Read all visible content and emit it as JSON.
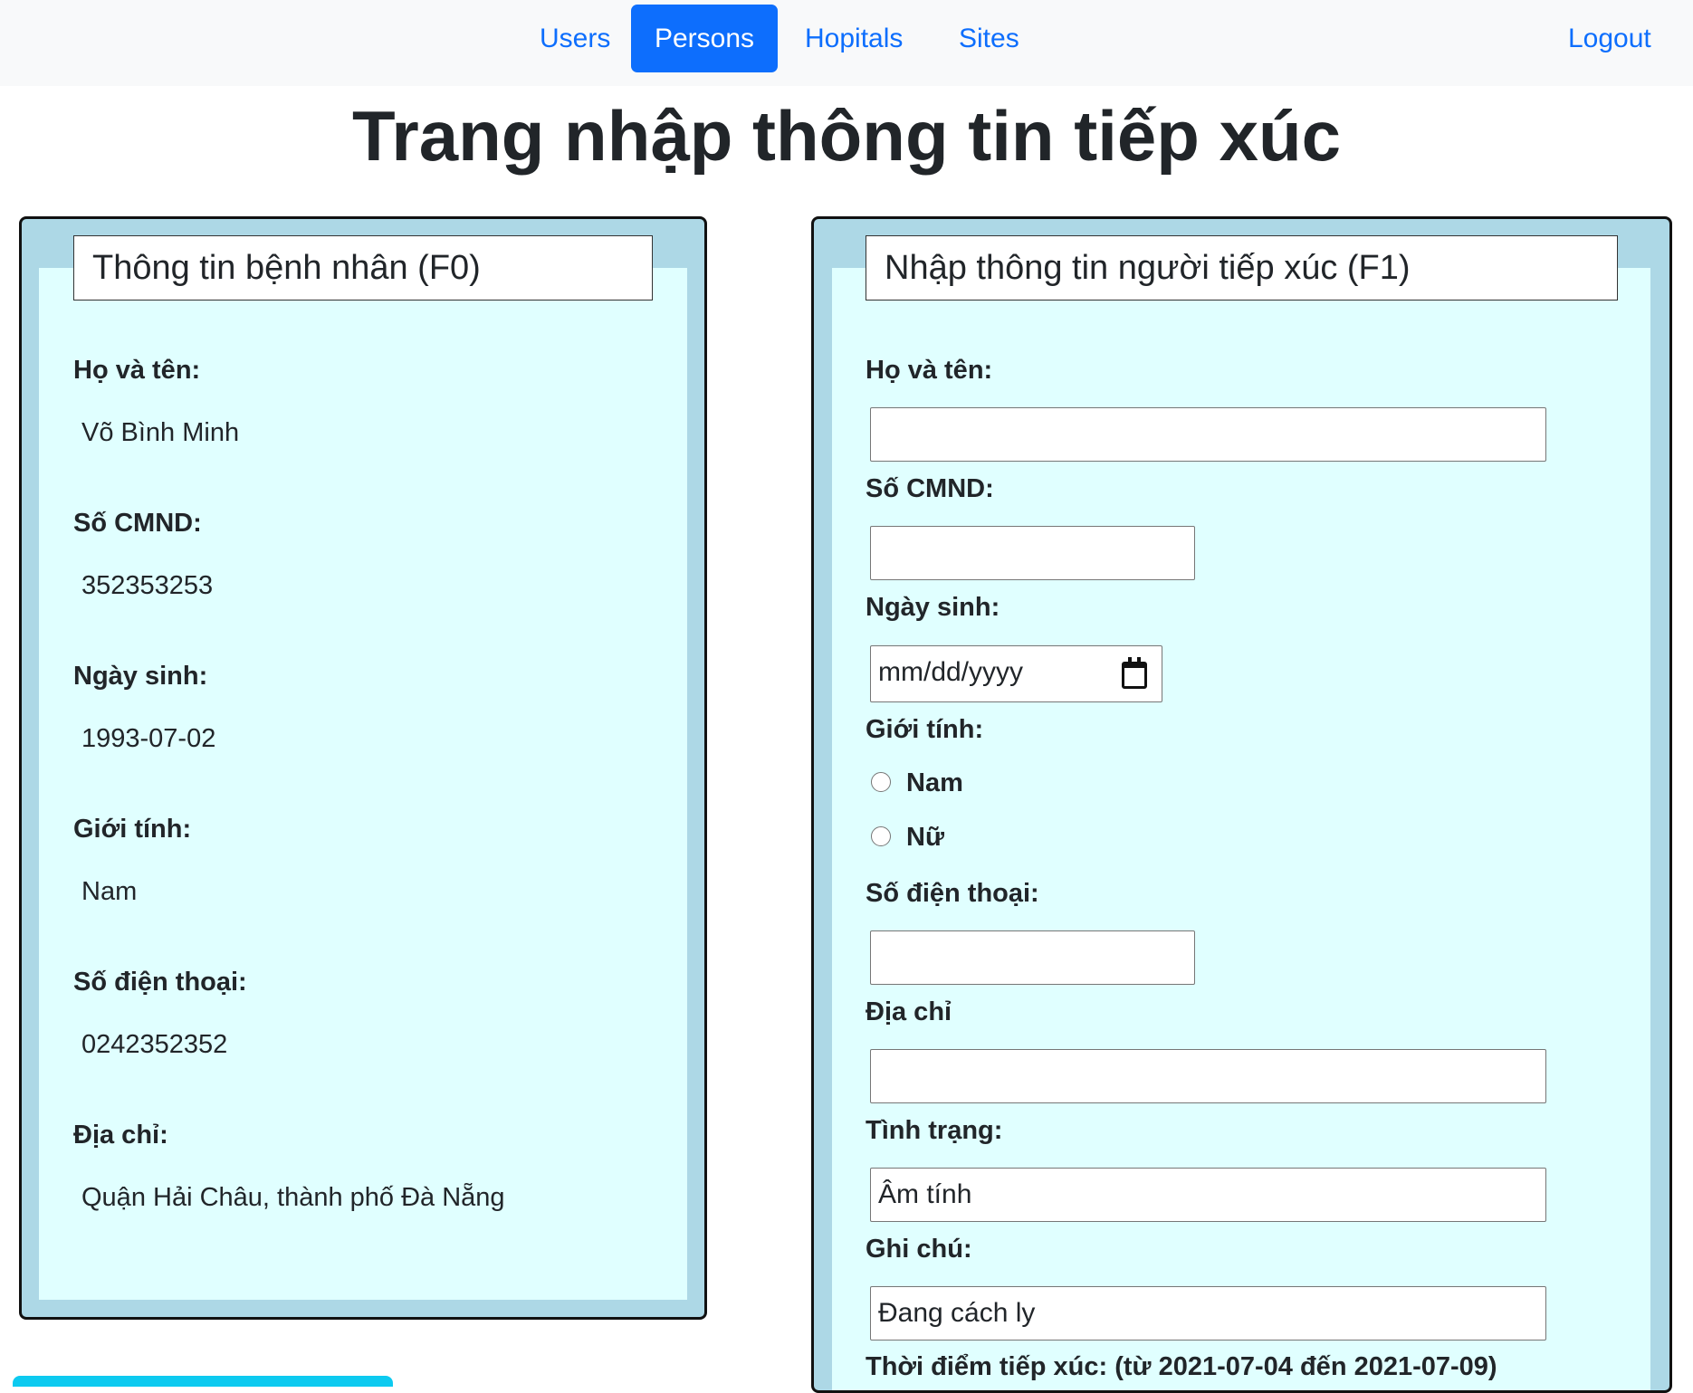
{
  "nav": {
    "items": [
      "Users",
      "Persons",
      "Hopitals",
      "Sites"
    ],
    "active": "Persons",
    "logout": "Logout"
  },
  "page_title": "Trang nhập thông tin tiếp xúc",
  "patient": {
    "header": "Thông tin bệnh nhân (F0)",
    "fields": [
      {
        "label": "Họ và tên:",
        "value": "Võ Bình Minh"
      },
      {
        "label": "Số CMND:",
        "value": "352353253"
      },
      {
        "label": "Ngày sinh:",
        "value": "1993-07-02"
      },
      {
        "label": "Giới tính:",
        "value": "Nam"
      },
      {
        "label": "Số điện thoại:",
        "value": "0242352352"
      },
      {
        "label": "Địa chỉ:",
        "value": "Quận Hải Châu, thành phố Đà Nẵng"
      }
    ]
  },
  "contact": {
    "header": "Nhập thông tin người tiếp xúc (F1)",
    "name_label": "Họ và tên:",
    "name_value": "",
    "cmnd_label": "Số CMND:",
    "cmnd_value": "",
    "dob_label": "Ngày sinh:",
    "dob_placeholder": "mm/dd/yyyy",
    "gender_label": "Giới tính:",
    "gender_options": [
      "Nam",
      "Nữ"
    ],
    "phone_label": "Số điện thoại:",
    "phone_value": "",
    "address_label": "Địa chỉ",
    "address_value": "",
    "status_label": "Tình trạng:",
    "status_value": "Âm tính",
    "note_label": "Ghi chú:",
    "note_value": "Đang cách ly",
    "contact_time_label": "Thời điểm tiếp xúc: (từ 2021-07-04 đến 2021-07-09)"
  },
  "colors": {
    "panel_border": "#add8e6",
    "panel_fill": "#e0ffff",
    "nav_active": "#0d6efd",
    "nav_bg": "#f8f9fa"
  }
}
